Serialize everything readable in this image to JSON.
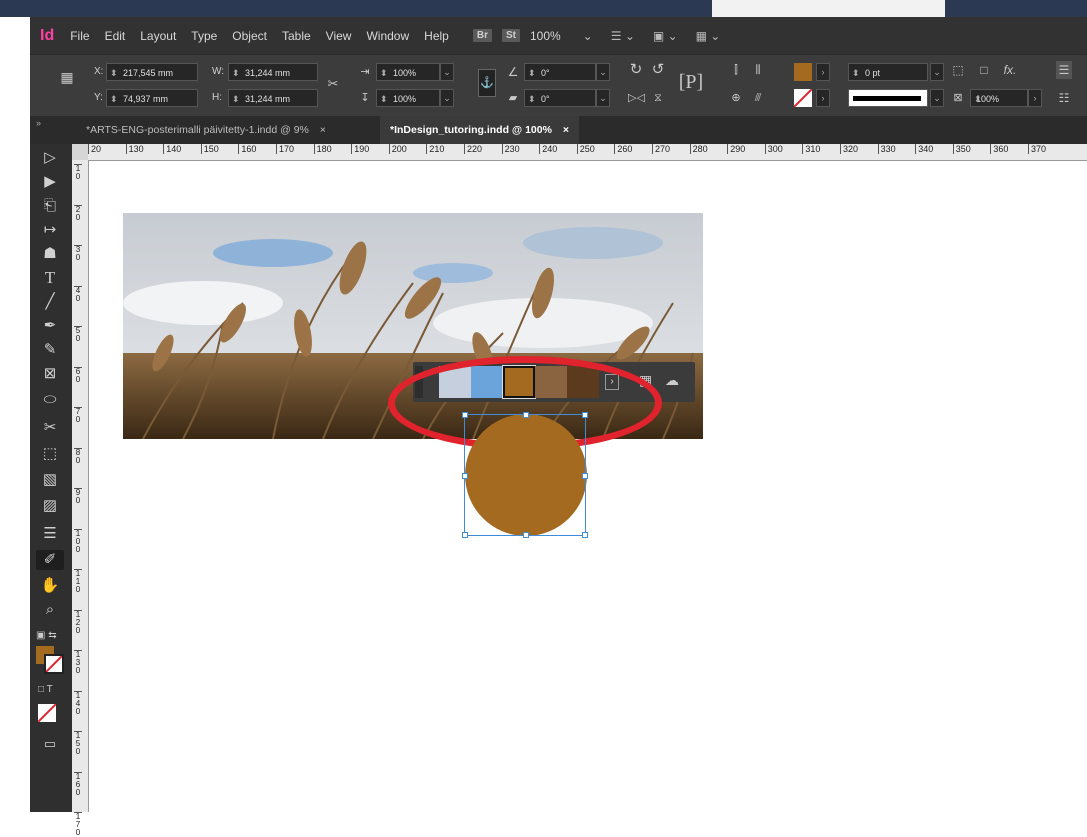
{
  "app": {
    "logo": "Id"
  },
  "menu": [
    "File",
    "Edit",
    "Layout",
    "Type",
    "Object",
    "Table",
    "View",
    "Window",
    "Help"
  ],
  "menu_badges": {
    "bridge": "Br",
    "stock": "St"
  },
  "zoom": "100%",
  "control": {
    "x_label": "X:",
    "x_value": "217,545 mm",
    "y_label": "Y:",
    "y_value": "74,937 mm",
    "w_label": "W:",
    "w_value": "31,244 mm",
    "h_label": "H:",
    "h_value": "31,244 mm",
    "scale_x": "100%",
    "scale_y": "100%",
    "rotate": "0°",
    "shear": "0°",
    "stroke_weight": "0 pt",
    "opacity": "100%",
    "fx": "fx."
  },
  "tabs": [
    {
      "label": "*ARTS-ENG-posterimalli päivitetty-1.indd @ 9%",
      "close": "×"
    },
    {
      "label": "*InDesign_tutoring.indd @ 100%",
      "close": "×"
    }
  ],
  "hruler_ticks": [
    "20",
    "130",
    "140",
    "150",
    "160",
    "170",
    "180",
    "190",
    "200",
    "210",
    "220",
    "230",
    "240",
    "250",
    "260",
    "270",
    "280",
    "290",
    "300",
    "310",
    "320",
    "330",
    "340",
    "350",
    "360",
    "370"
  ],
  "vruler_ticks": [
    "10",
    "20",
    "30",
    "40",
    "50",
    "60",
    "70",
    "80",
    "90",
    "100",
    "110",
    "120",
    "130",
    "140",
    "150",
    "160",
    "170"
  ],
  "colors": {
    "fill": "#a46a1f",
    "swatches": [
      "#c5cfde",
      "#6ba3db",
      "#a46a1f",
      "#8a6440",
      "#5c3a1e"
    ],
    "highlight_ring": "#e0232d",
    "selection": "#3d8ddc"
  },
  "icons": {
    "selection_tool": "selection-tool-icon",
    "direct_selection": "direct-selection-icon",
    "page_tool": "page-tool-icon",
    "gap_tool": "gap-tool-icon",
    "content_collector": "content-collector-icon",
    "type_tool": "type-tool-icon",
    "line_tool": "line-tool-icon",
    "pen_tool": "pen-tool-icon",
    "pencil_tool": "pencil-tool-icon",
    "rect_frame": "rectangle-frame-icon",
    "ellipse_tool": "ellipse-tool-icon",
    "scissors": "scissors-icon",
    "free_transform": "free-transform-icon",
    "gradient": "gradient-icon",
    "gradient_feather": "gradient-feather-icon",
    "note": "note-icon",
    "eyedropper": "eyedropper-icon",
    "hand": "hand-icon",
    "zoom": "zoom-icon"
  }
}
